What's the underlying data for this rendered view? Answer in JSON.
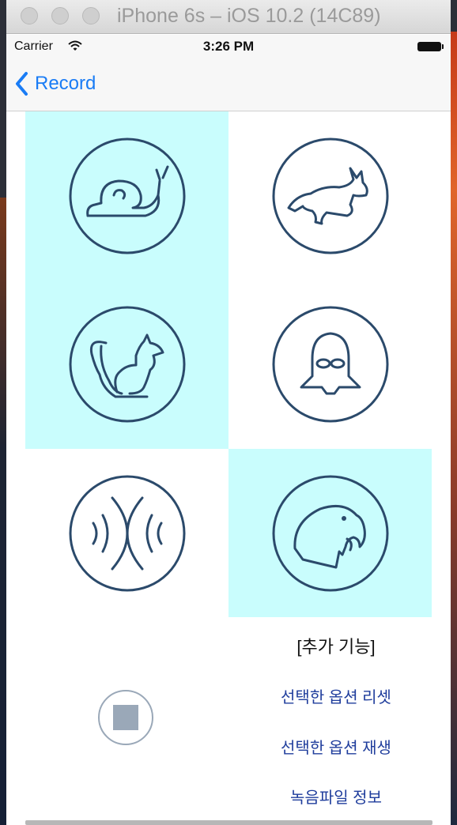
{
  "window": {
    "title": "iPhone 6s – iOS 10.2 (14C89)"
  },
  "status_bar": {
    "carrier": "Carrier",
    "time": "3:26 PM"
  },
  "nav": {
    "back_label": "Record"
  },
  "effects": [
    {
      "icon": "snail-icon",
      "selected": true
    },
    {
      "icon": "rabbit-icon",
      "selected": false
    },
    {
      "icon": "squirrel-icon",
      "selected": true
    },
    {
      "icon": "darth-vader-icon",
      "selected": false
    },
    {
      "icon": "echo-wave-icon",
      "selected": false
    },
    {
      "icon": "parrot-icon",
      "selected": true
    }
  ],
  "extra": {
    "title": "[추가 기능]",
    "reset_label": "선택한 옵션 리셋",
    "play_label": "선택한 옵션 재생",
    "info_label": "녹음파일 정보"
  },
  "colors": {
    "selected_bg": "#c9fdfd",
    "icon_stroke": "#2b4a6b",
    "link": "#1a7cf5",
    "option_text": "#1f3d9c"
  }
}
